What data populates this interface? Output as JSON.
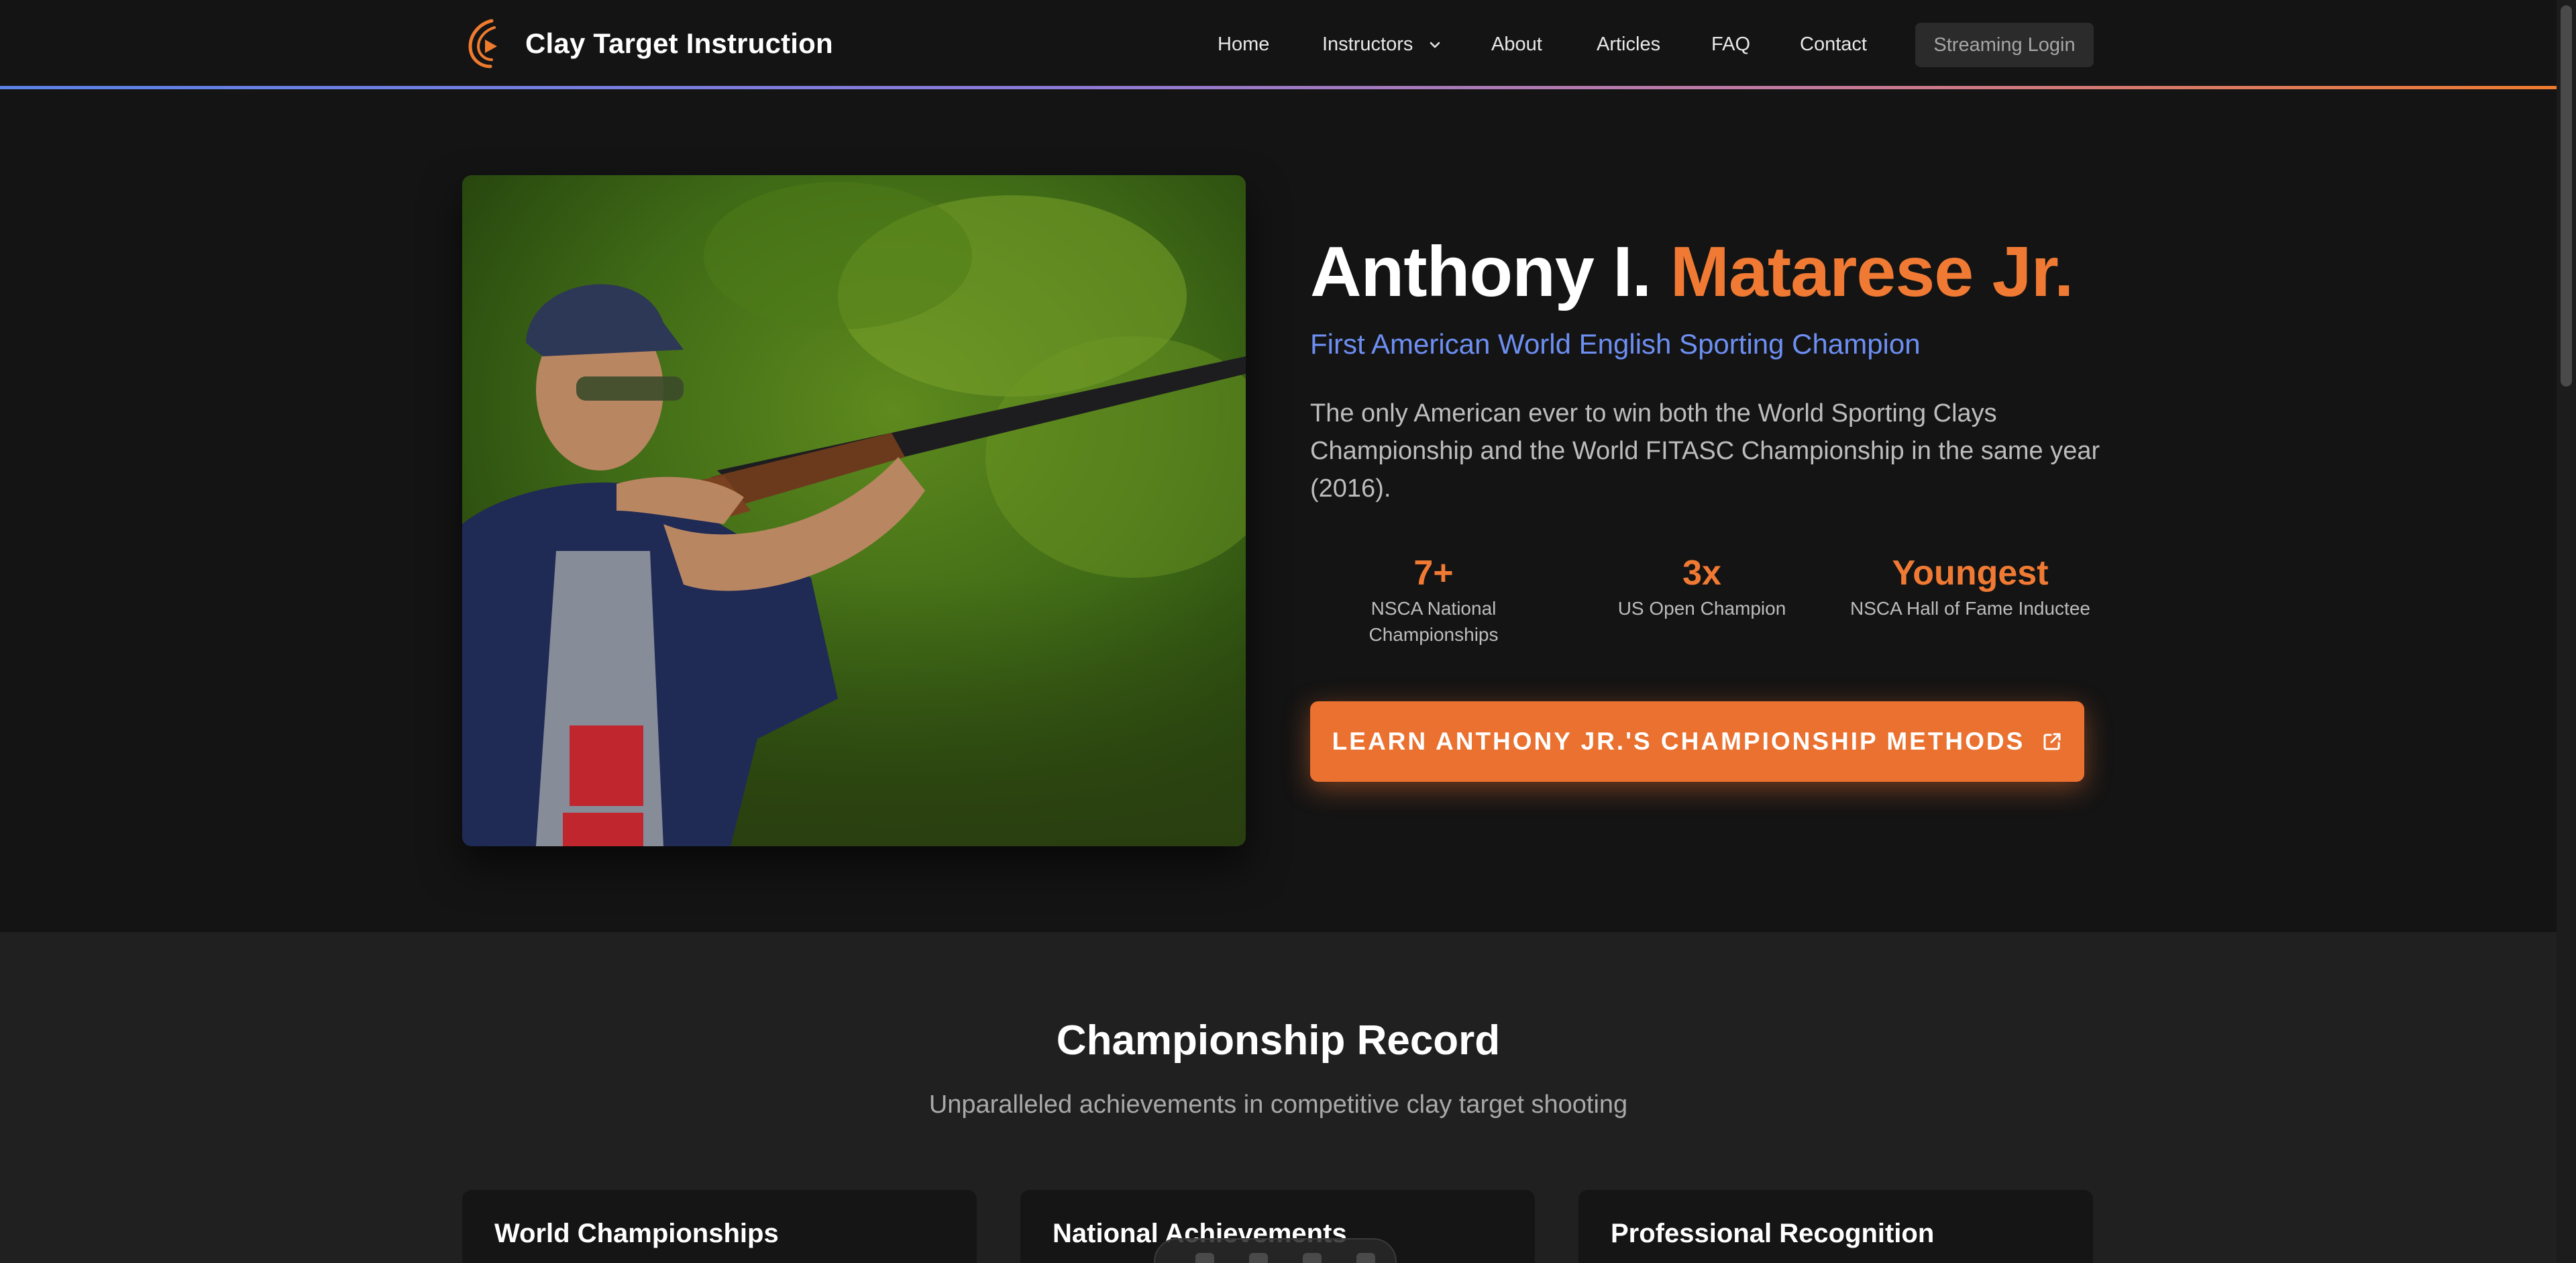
{
  "brand": {
    "name": "Clay Target Instruction",
    "icon": "flame-target-logo-icon"
  },
  "nav": {
    "links": [
      "Home",
      "Instructors",
      "About",
      "Articles",
      "FAQ",
      "Contact"
    ],
    "instructors_dropdown_icon": "chevron-down-icon",
    "login": "Streaming Login"
  },
  "hero": {
    "name_first": "Anthony I. ",
    "name_last": "Matarese Jr.",
    "subtitle": "First American World English Sporting Champion",
    "description": "The only American ever to win both the World Sporting Clays Championship and the World FITASC Championship in the same year (2016).",
    "stats": [
      {
        "value": "7+",
        "label": "NSCA National Championships"
      },
      {
        "value": "3x",
        "label": "US Open Champion"
      },
      {
        "value": "Youngest",
        "label": "NSCA Hall of Fame Inductee"
      }
    ],
    "cta": "LEARN ANTHONY JR.'S CHAMPIONSHIP METHODS",
    "cta_icon": "external-link-icon"
  },
  "record": {
    "title": "Championship Record",
    "subtitle": "Unparalleled achievements in competitive clay target shooting",
    "cards": [
      "World Championships",
      "National Achievements",
      "Professional Recognition"
    ]
  },
  "colors": {
    "accent": "#f07a33",
    "link_blue": "#6d8ff3",
    "background": "#141414",
    "section": "#202020"
  }
}
